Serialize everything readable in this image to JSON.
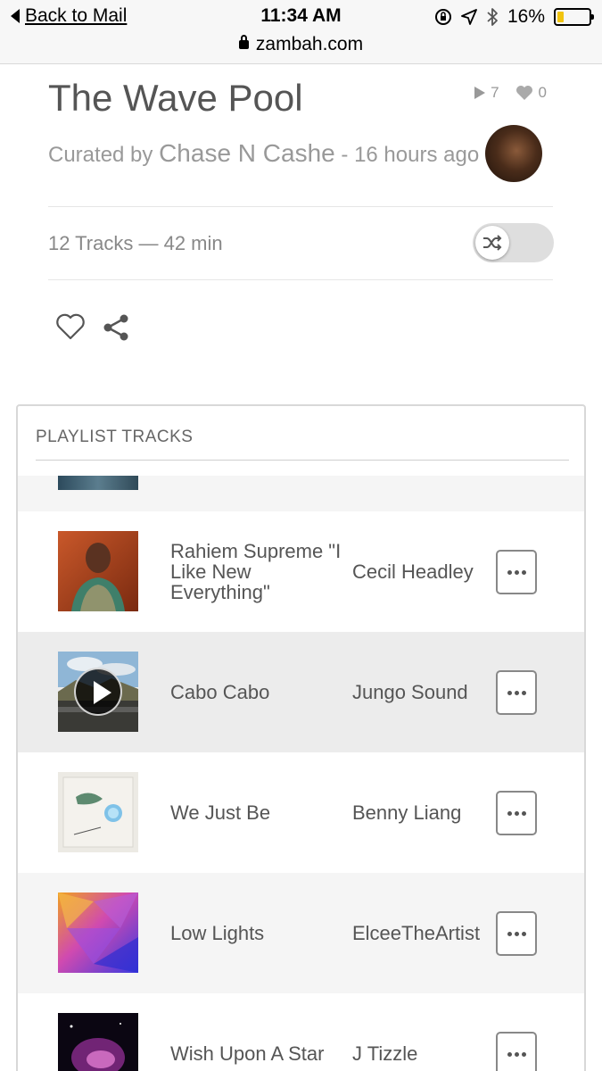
{
  "status_bar": {
    "back_label": "Back to Mail",
    "time": "11:34 AM",
    "url": "zambah.com",
    "battery": "16%",
    "battery_level": 0.16,
    "icons": [
      "orientation-lock-icon",
      "location-icon",
      "bluetooth-icon",
      "battery-icon"
    ]
  },
  "playlist": {
    "title": "The Wave Pool",
    "play_count": "7",
    "like_count": "0",
    "curated_prefix": "Curated by",
    "curator": "Chase N Cashe",
    "time_ago": "- 16 hours ago",
    "summary": "12 Tracks — 42 min"
  },
  "panel": {
    "heading": "PLAYLIST TRACKS"
  },
  "tracks": [
    {
      "title": "Rahiem Supreme \"I Like New Everything\"",
      "artist": "Cecil Headley",
      "thumb": "portrait-cover"
    },
    {
      "title": "Cabo Cabo",
      "artist": "Jungo Sound",
      "thumb": "landscape-cover"
    },
    {
      "title": "We Just Be",
      "artist": "Benny Liang",
      "thumb": "illustration-cover"
    },
    {
      "title": "Low Lights",
      "artist": "ElceeTheArtist",
      "thumb": "polygon-cover"
    },
    {
      "title": "Wish Upon A Star",
      "artist": "J Tizzle",
      "thumb": "nebula-cover"
    }
  ],
  "colors": {
    "text": "#555555",
    "muted": "#999999",
    "active_row": "#ececec",
    "alt_row": "#f5f5f5",
    "battery_fill": "#f1c40f"
  }
}
